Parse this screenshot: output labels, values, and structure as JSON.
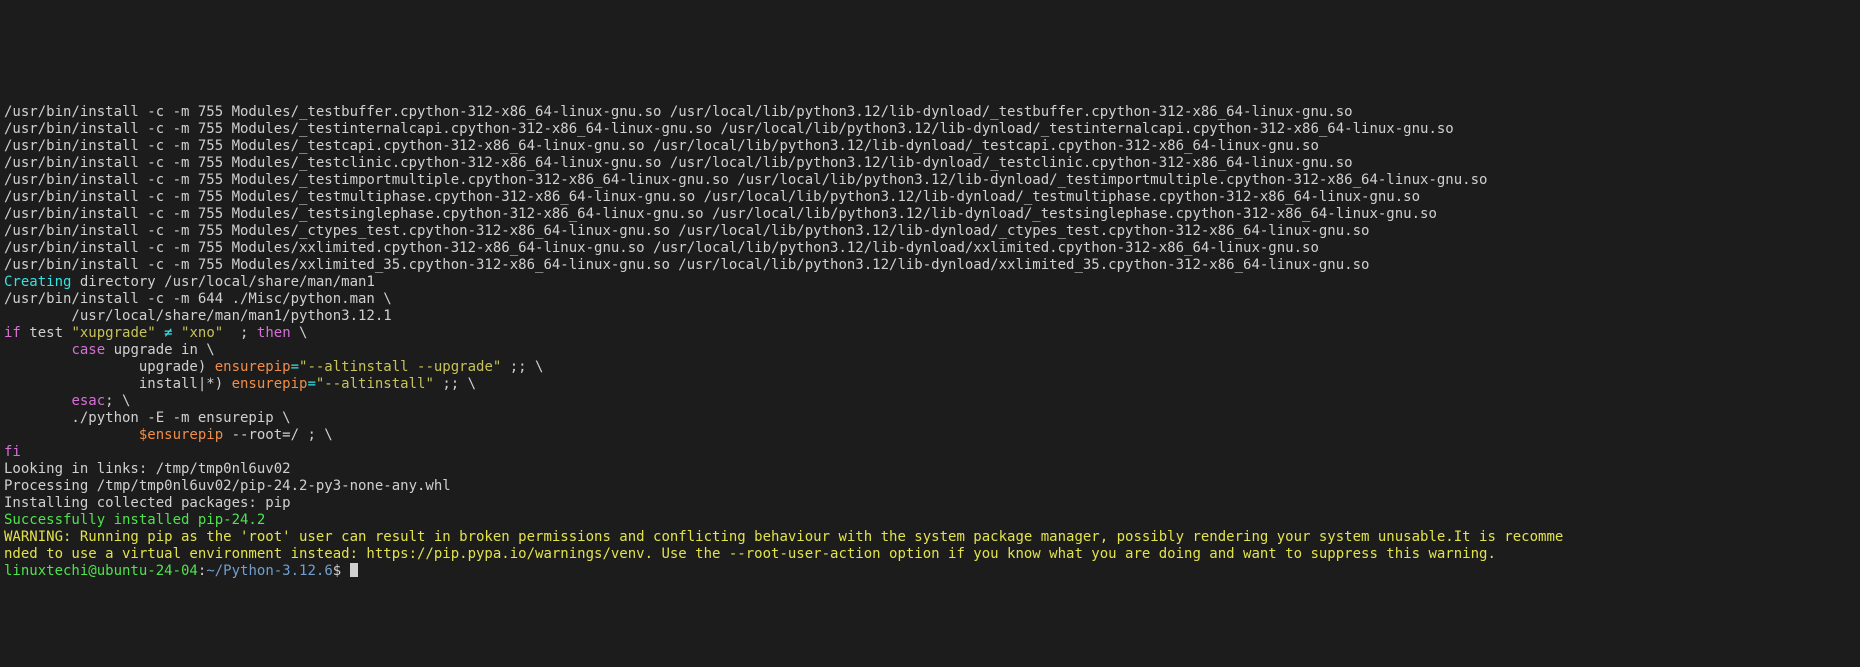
{
  "lines": {
    "install_01": "/usr/bin/install -c -m 755 Modules/_testbuffer.cpython-312-x86_64-linux-gnu.so /usr/local/lib/python3.12/lib-dynload/_testbuffer.cpython-312-x86_64-linux-gnu.so",
    "install_02": "/usr/bin/install -c -m 755 Modules/_testinternalcapi.cpython-312-x86_64-linux-gnu.so /usr/local/lib/python3.12/lib-dynload/_testinternalcapi.cpython-312-x86_64-linux-gnu.so",
    "install_03": "/usr/bin/install -c -m 755 Modules/_testcapi.cpython-312-x86_64-linux-gnu.so /usr/local/lib/python3.12/lib-dynload/_testcapi.cpython-312-x86_64-linux-gnu.so",
    "install_04": "/usr/bin/install -c -m 755 Modules/_testclinic.cpython-312-x86_64-linux-gnu.so /usr/local/lib/python3.12/lib-dynload/_testclinic.cpython-312-x86_64-linux-gnu.so",
    "install_05": "/usr/bin/install -c -m 755 Modules/_testimportmultiple.cpython-312-x86_64-linux-gnu.so /usr/local/lib/python3.12/lib-dynload/_testimportmultiple.cpython-312-x86_64-linux-gnu.so",
    "install_06": "/usr/bin/install -c -m 755 Modules/_testmultiphase.cpython-312-x86_64-linux-gnu.so /usr/local/lib/python3.12/lib-dynload/_testmultiphase.cpython-312-x86_64-linux-gnu.so",
    "install_07": "/usr/bin/install -c -m 755 Modules/_testsinglephase.cpython-312-x86_64-linux-gnu.so /usr/local/lib/python3.12/lib-dynload/_testsinglephase.cpython-312-x86_64-linux-gnu.so",
    "install_08": "/usr/bin/install -c -m 755 Modules/_ctypes_test.cpython-312-x86_64-linux-gnu.so /usr/local/lib/python3.12/lib-dynload/_ctypes_test.cpython-312-x86_64-linux-gnu.so",
    "install_09": "/usr/bin/install -c -m 755 Modules/xxlimited.cpython-312-x86_64-linux-gnu.so /usr/local/lib/python3.12/lib-dynload/xxlimited.cpython-312-x86_64-linux-gnu.so",
    "install_10": "/usr/bin/install -c -m 755 Modules/xxlimited_35.cpython-312-x86_64-linux-gnu.so /usr/local/lib/python3.12/lib-dynload/xxlimited_35.cpython-312-x86_64-linux-gnu.so",
    "creating_word": "Creating",
    "creating_rest": " directory /usr/local/share/man/man1",
    "install_man": "/usr/bin/install -c -m 644 ./Misc/python.man \\",
    "install_man2": "        /usr/local/share/man/man1/python3.12.1",
    "if_word": "if",
    "test_word": " test ",
    "xupgrade": "\"xupgrade\"",
    "ne_op": " ≠ ",
    "xno": "\"xno\"",
    "semi_then": "  ; ",
    "then_word": "then",
    "backslash": " \\",
    "case_indent": "        ",
    "case_word": "case",
    "case_rest": " upgrade in \\",
    "upgrade_line_pre": "                upgrade) ",
    "ensurepip_var": "ensurepip",
    "equals": "=",
    "altinstall_upgrade": "\"--altinstall --upgrade\"",
    "semisemi_bs": " ;; \\",
    "install_line_pre": "                install|*) ",
    "altinstall": "\"--altinstall\"",
    "esac_indent": "        ",
    "esac_word": "esac",
    "semi_bs": "; \\",
    "python_line": "        ./python -E -m ensurepip \\",
    "ensurepip_indent": "                ",
    "ensurepip_dollar": "$ensurepip",
    "root_flag": " --root=/ ; \\",
    "fi_word": "fi",
    "looking": "Looking in links: /tmp/tmp0nl6uv02",
    "processing": "Processing /tmp/tmp0nl6uv02/pip-24.2-py3-none-any.whl",
    "installing": "Installing collected packages: pip",
    "success": "Successfully installed pip-24.2",
    "warning1": "WARNING: Running pip as the 'root' user can result in broken permissions and conflicting behaviour with the system package manager, possibly rendering your system unusable.It is recomme",
    "warning2": "nded to use a virtual environment instead: https://pip.pypa.io/warnings/venv. Use the --root-user-action option if you know what you are doing and want to suppress this warning.",
    "prompt_user": "linuxtechi@ubuntu-24-04",
    "prompt_colon": ":",
    "prompt_path": "~/Python-3.12.6",
    "prompt_dollar": "$ "
  }
}
